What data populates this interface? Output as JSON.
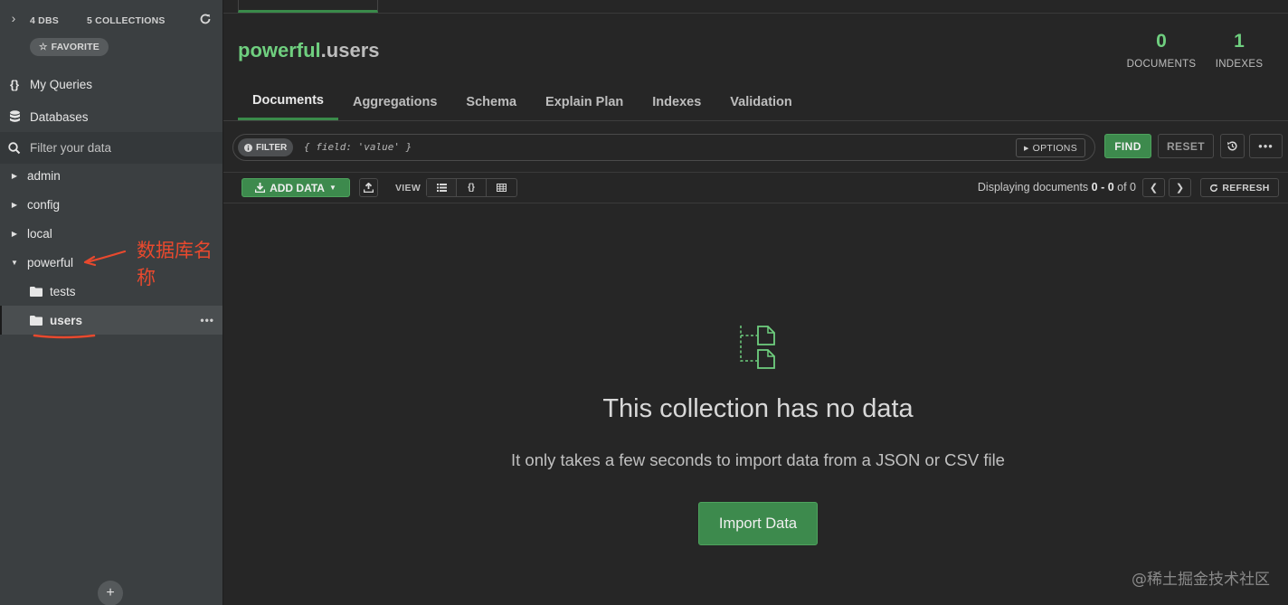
{
  "sidebar": {
    "db_count": "4 DBS",
    "collection_count": "5 COLLECTIONS",
    "favorite_label": "FAVORITE",
    "nav": [
      {
        "label": "My Queries",
        "icon": "curly-braces-icon"
      },
      {
        "label": "Databases",
        "icon": "database-icon"
      }
    ],
    "filter_placeholder": "Filter your data",
    "databases": [
      {
        "name": "admin",
        "expanded": false
      },
      {
        "name": "config",
        "expanded": false
      },
      {
        "name": "local",
        "expanded": false
      },
      {
        "name": "powerful",
        "expanded": true,
        "collections": [
          {
            "name": "tests",
            "active": false
          },
          {
            "name": "users",
            "active": true
          }
        ]
      }
    ],
    "annotation": "数据库名称"
  },
  "main": {
    "namespace_db": "powerful",
    "namespace_coll": ".users",
    "documents_count": "0",
    "documents_label": "DOCUMENTS",
    "indexes_count": "1",
    "indexes_label": "INDEXES",
    "tabs": [
      {
        "label": "Documents",
        "active": true
      },
      {
        "label": "Aggregations",
        "active": false
      },
      {
        "label": "Schema",
        "active": false
      },
      {
        "label": "Explain Plan",
        "active": false
      },
      {
        "label": "Indexes",
        "active": false
      },
      {
        "label": "Validation",
        "active": false
      }
    ],
    "query": {
      "filter_label": "FILTER",
      "placeholder": "{ field: 'value' }",
      "options_label": "OPTIONS",
      "find_label": "FIND",
      "reset_label": "RESET"
    },
    "toolbar": {
      "add_data_label": "ADD DATA",
      "view_label": "VIEW",
      "displaying_prefix": "Displaying documents ",
      "displaying_range": "0 - 0",
      "displaying_suffix": " of 0",
      "refresh_label": "REFRESH"
    },
    "empty": {
      "title": "This collection has no data",
      "subtitle": "It only takes a few seconds to import data from a JSON or CSV file",
      "import_label": "Import Data"
    }
  },
  "watermark": "@稀土掘金技术社区",
  "colors": {
    "accent": "#3d8a4d",
    "accent_text": "#6fcf7f",
    "annotation": "#e8492e",
    "background": "#262626",
    "sidebar": "#3b3f41"
  }
}
